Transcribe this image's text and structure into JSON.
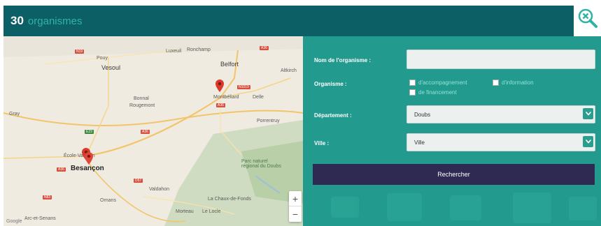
{
  "header": {
    "count": "30",
    "count_label": "organismes"
  },
  "icons": {
    "close": "close-search-icon",
    "dropdown": "chevron-down-icon",
    "marker": "map-marker-icon"
  },
  "colors": {
    "header_bg": "#0d5f66",
    "accent": "#2fb3a4",
    "panel_bg": "#239a8e",
    "button_bg": "#2e2a52"
  },
  "map": {
    "labels": {
      "luxeuil": "Luxeuil",
      "ronchamp": "Ronchamp",
      "poisy": "Pouy",
      "vesoul": "Vesoul",
      "belfort": "Belfort",
      "altkirch": "Altkirch",
      "montbeliard": "Montbéliard",
      "delle": "Delle",
      "bonnal": "Bonnal",
      "rougemont": "Rougemont",
      "gray": "Gray",
      "pontarlier": "Porrentruy",
      "ecole": "École-Valentin",
      "besancon": "Besançon",
      "valdahon": "Valdahon",
      "ornans": "Ornans",
      "parc": "Parc naturel régional du Doubs",
      "chauxdefonds": "La Chaux-de-Fonds",
      "morteau": "Morteau",
      "locle": "Le Locle",
      "arcsenans": "Arc-et-Senans",
      "credit": "Google"
    },
    "roads": {
      "n19a": "N19",
      "a36a": "A36",
      "n1019": "N1019",
      "a36b": "A36",
      "a36c": "A36",
      "e23": "E23",
      "a36d": "A36",
      "n83": "N83",
      "d57": "D57"
    },
    "zoom_in": "+",
    "zoom_out": "−"
  },
  "form": {
    "name_label": "Nom de l'organisme :",
    "name_value": "",
    "type_label": "Organisme :",
    "types": [
      "d'accompagnement",
      "d'information",
      "de financement"
    ],
    "dept_label": "Département :",
    "dept_value": "Doubs",
    "city_label": "Ville :",
    "city_value": "Ville",
    "search_button": "Rechercher"
  }
}
